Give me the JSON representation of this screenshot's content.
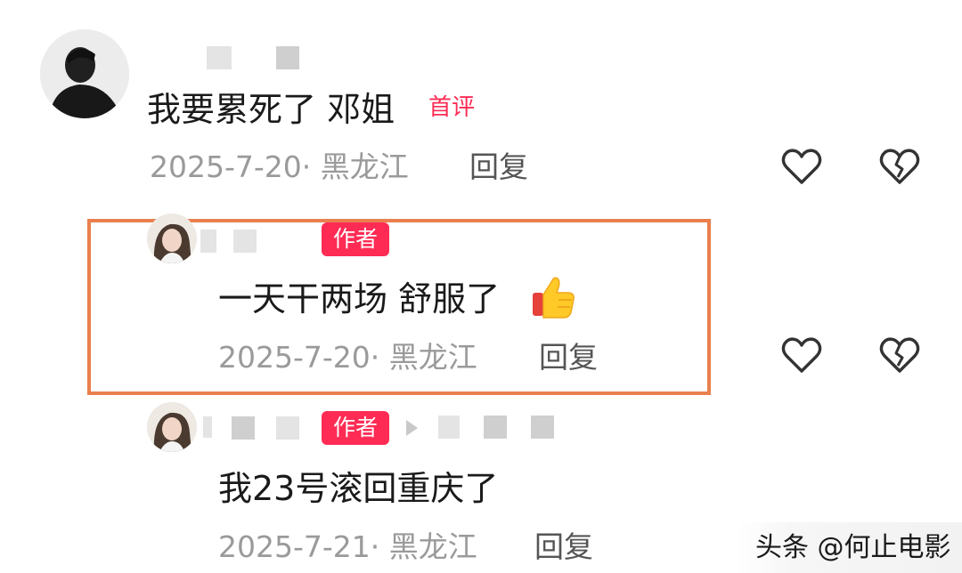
{
  "comments": [
    {
      "text": "我要累死了 邓姐",
      "badge": "首评",
      "meta": "2025-7-20· 黑龙江",
      "reply_label": "回复"
    },
    {
      "text": "一天干两场 舒服了",
      "badge": "作者",
      "emoji": "thumbs-up",
      "meta": "2025-7-20· 黑龙江",
      "reply_label": "回复"
    },
    {
      "text": "我23号滚回重庆了",
      "badge": "作者",
      "meta": "2025-7-21· 黑龙江",
      "reply_label": "回复"
    }
  ],
  "watermark": "头条 @何止电影",
  "colors": {
    "accent": "#fe2c55",
    "highlight_border": "#e9804e",
    "meta_text": "#9a9a9a"
  },
  "icons": [
    "heart-outline-icon",
    "broken-heart-icon",
    "thumbs-up-emoji",
    "triangle-arrow-icon"
  ]
}
